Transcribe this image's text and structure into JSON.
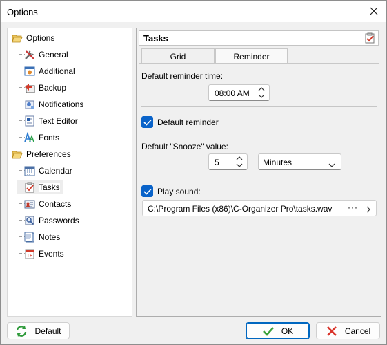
{
  "window": {
    "title": "Options"
  },
  "tree": {
    "options_group": "Options",
    "options_items": [
      "General",
      "Additional",
      "Backup",
      "Notifications",
      "Text Editor",
      "Fonts"
    ],
    "preferences_group": "Preferences",
    "preferences_items": [
      "Calendar",
      "Tasks",
      "Contacts",
      "Passwords",
      "Notes",
      "Events"
    ],
    "selected": "Tasks"
  },
  "panel": {
    "title": "Tasks",
    "tabs": [
      "Grid",
      "Reminder"
    ],
    "active_tab": "Reminder",
    "default_reminder_time_label": "Default reminder time:",
    "default_reminder_time_value": "08:00 AM",
    "default_reminder_label": "Default reminder",
    "default_reminder_checked": true,
    "snooze_label": "Default \"Snooze\" value:",
    "snooze_value": "5",
    "snooze_unit": "Minutes",
    "play_sound_label": "Play sound:",
    "play_sound_checked": true,
    "sound_path": "C:\\Program Files (x86)\\C-Organizer Pro\\tasks.wav",
    "browse_dots": "···"
  },
  "footer": {
    "default_label": "Default",
    "ok_label": "OK",
    "cancel_label": "Cancel"
  },
  "colors": {
    "accent": "#0a63c9",
    "ok_green": "#3aa13a",
    "cancel_red": "#d9342b"
  }
}
